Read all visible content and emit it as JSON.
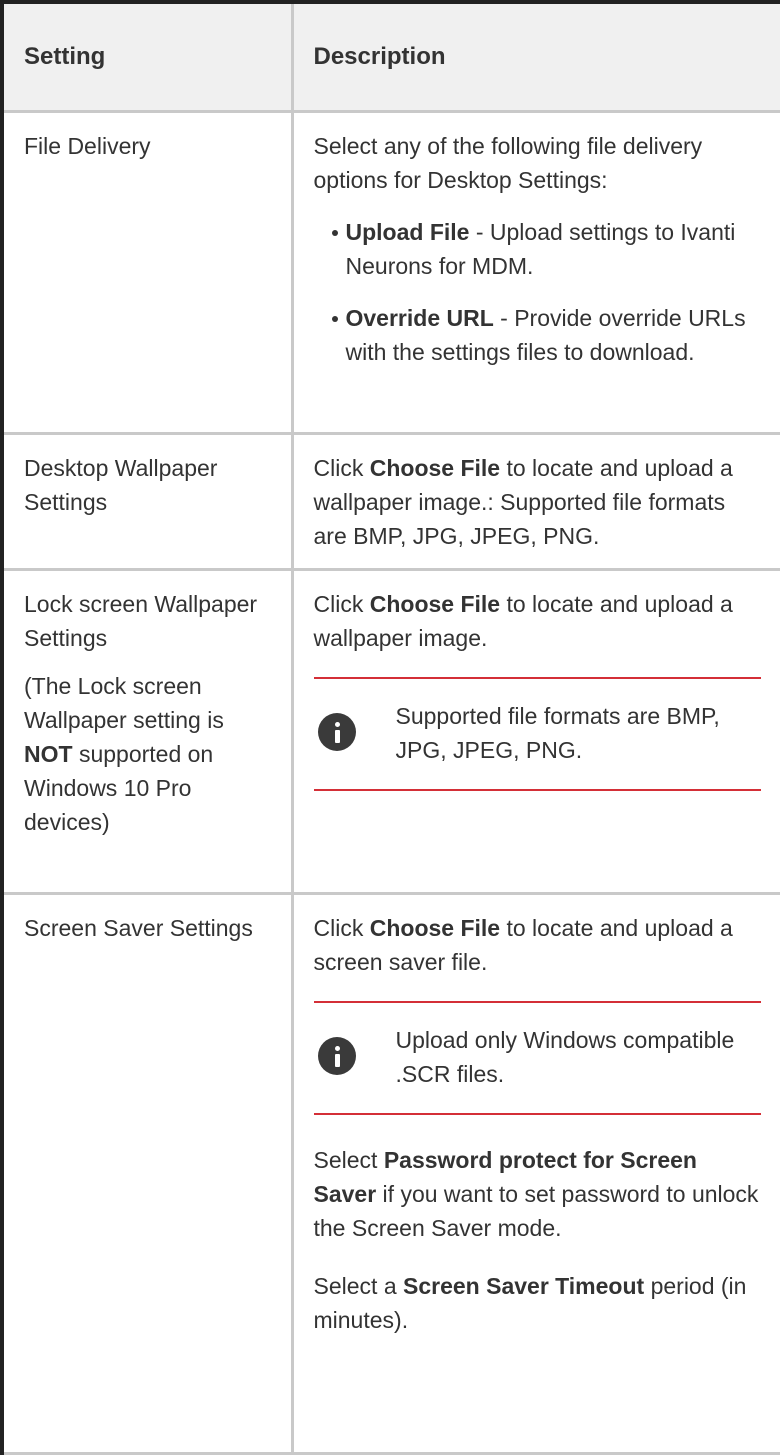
{
  "table": {
    "headers": [
      "Setting",
      "Description"
    ],
    "rows": {
      "file_delivery": {
        "setting": "File Delivery",
        "intro": "Select any of the following file delivery options for Desktop Settings:",
        "options": [
          {
            "bold": "Upload File",
            "text": " - Upload settings to Ivanti Neurons for MDM."
          },
          {
            "bold": "Override URL",
            "text": " - Provide override URLs with the settings files to download."
          }
        ]
      },
      "desktop_wallpaper": {
        "setting": "Desktop Wallpaper Settings",
        "pre": "Click ",
        "bold": "Choose File",
        "post": " to locate and upload a wallpaper image.: Supported file formats are BMP, JPG, JPEG, PNG."
      },
      "lock_screen": {
        "setting": "Lock screen Wallpaper Settings",
        "note_pre": "(The Lock screen Wallpaper setting is ",
        "note_bold": "NOT",
        "note_post": " supported on Windows 10 Pro devices)",
        "pre": "Click ",
        "bold": "Choose File",
        "post": " to locate and upload a wallpaper image.",
        "callout": "Supported file formats are BMP, JPG, JPEG, PNG."
      },
      "screen_saver": {
        "setting": "Screen Saver Settings",
        "pre": "Click ",
        "bold": "Choose File",
        "post": " to locate and upload a screen saver file.",
        "callout": "Upload only Windows compatible .SCR files.",
        "password_pre": "Select ",
        "password_bold": "Password protect for Screen Saver",
        "password_post": " if you want to set password to unlock the Screen Saver mode.",
        "timeout_pre": "Select a ",
        "timeout_bold": "Screen Saver Timeout",
        "timeout_post": " period (in minutes)."
      }
    }
  },
  "icons": {
    "info": "info-icon"
  },
  "colors": {
    "callout_rule": "#d42f37",
    "header_bg": "#f0f0f0",
    "grid": "#c9c9c9"
  }
}
